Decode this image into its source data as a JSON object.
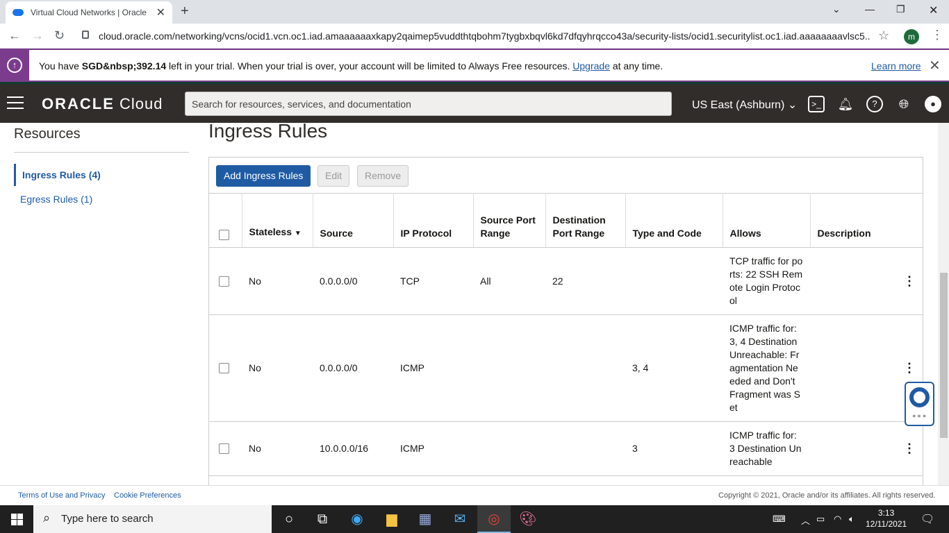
{
  "browser": {
    "tab_title": "Virtual Cloud Networks | Oracle C",
    "url": "cloud.oracle.com/networking/vcns/ocid1.vcn.oc1.iad.amaaaaaaxkapy2qaimep5vuddthtqbohm7tygbxbqvl6kd7dfqyhrqcco43a/security-lists/ocid1.securitylist.oc1.iad.aaaaaaaavlsc5...",
    "profile_initial": "m"
  },
  "banner": {
    "prefix": "You have ",
    "amount": "SGD&nbsp;392.14",
    "middle": " left in your trial. When your trial is over, your account will be limited to Always Free resources. ",
    "upgrade": "Upgrade",
    "suffix": " at any time.",
    "learn_more": "Learn more"
  },
  "header": {
    "logo_bold": "ORACLE",
    "logo_rest": " Cloud",
    "search_placeholder": "Search for resources, services, and documentation",
    "region": "US East (Ashburn)"
  },
  "sidebar": {
    "title": "Resources",
    "items": [
      {
        "label": "Ingress Rules (4)"
      },
      {
        "label": "Egress Rules (1)"
      }
    ]
  },
  "main": {
    "title": "Ingress Rules",
    "buttons": {
      "add": "Add Ingress Rules",
      "edit": "Edit",
      "remove": "Remove"
    },
    "columns": [
      "Stateless",
      "Source",
      "IP Protocol",
      "Source Port Range",
      "Destination Port Range",
      "Type and Code",
      "Allows",
      "Description"
    ],
    "rows": [
      {
        "stateless": "No",
        "source": "0.0.0.0/0",
        "protocol": "TCP",
        "src_port": "All",
        "dst_port": "22",
        "type_code": "",
        "allows": "TCP traffic for ports: 22 SSH Remote Login Protocol",
        "description": ""
      },
      {
        "stateless": "No",
        "source": "0.0.0.0/0",
        "protocol": "ICMP",
        "src_port": "",
        "dst_port": "",
        "type_code": "3, 4",
        "allows": "ICMP traffic for: 3, 4 Destination Unreachable: Fragmentation Needed and Don't Fragment was Set",
        "description": ""
      },
      {
        "stateless": "No",
        "source": "10.0.0.0/16",
        "protocol": "ICMP",
        "src_port": "",
        "dst_port": "",
        "type_code": "3",
        "allows": "ICMP traffic for: 3 Destination Unreachable",
        "description": ""
      }
    ]
  },
  "footer": {
    "terms": "Terms of Use and Privacy",
    "cookies": "Cookie Preferences",
    "copyright": "Copyright © 2021, Oracle and/or its affiliates. All rights reserved."
  },
  "taskbar": {
    "search_placeholder": "Type here to search",
    "time": "3:13",
    "date": "12/11/2021"
  }
}
